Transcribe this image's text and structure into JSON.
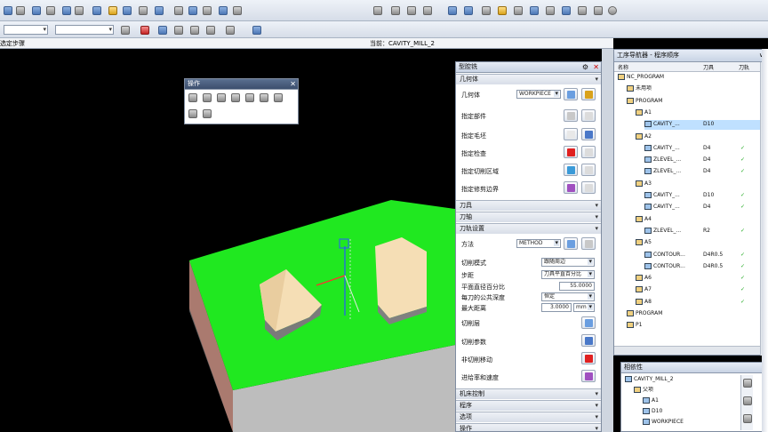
{
  "toolbar": {
    "row2": {
      "filter_value": "",
      "selection_value": ""
    }
  },
  "viewport": {
    "left_caption": "选定步骤",
    "center_caption": "当前：CAVITY_MILL_2",
    "floating_toolbar": {
      "title": "操作"
    },
    "colors": {
      "part_top": "#20e820",
      "part_side": "#bcbcbc",
      "blocks": "#f5deb5",
      "background": "#000000"
    }
  },
  "dialog": {
    "title": "型腔铣",
    "sections": {
      "geometry": "几何体",
      "tool": "刀具",
      "tool_axis": "刀轴",
      "path_settings": "刀轨设置",
      "machine_control": "机床控制",
      "program": "程序",
      "options": "选项",
      "actions": "操作"
    },
    "geometry": {
      "geometry_label": "几何体",
      "geometry_value": "WORKPIECE",
      "specify_part": "指定部件",
      "specify_blank": "指定毛坯",
      "specify_check": "指定检查",
      "specify_cut_area": "指定切削区域",
      "specify_trim": "指定修剪边界"
    },
    "path": {
      "method_label": "方法",
      "method_value": "METHOD",
      "cut_mode_label": "切削模式",
      "cut_mode_value": "跟随周边",
      "stepover_label": "步距",
      "stepover_value": "刀具平直百分比",
      "percent_label": "平面直径百分比",
      "percent_value": "55.0000",
      "global_depth_label": "每刀的公共深度",
      "global_depth_value": "恒定",
      "max_distance_label": "最大距离",
      "max_distance_value": "3.0000",
      "max_distance_unit": "mm",
      "cut_levels": "切削层",
      "cut_params": "切削参数",
      "non_cut_moves": "非切削移动",
      "feeds_speeds": "进给率和速度"
    }
  },
  "navigator": {
    "title": "工序导航器 - 程序顺序",
    "columns": {
      "name": "名称",
      "tool": "刀具",
      "path": "刀轨"
    },
    "rows": [
      {
        "indent": 0,
        "text": "NC_PROGRAM",
        "tool": "",
        "check": ""
      },
      {
        "indent": 1,
        "text": "未用项",
        "tool": "",
        "check": ""
      },
      {
        "indent": 1,
        "text": "PROGRAM",
        "tool": "",
        "check": ""
      },
      {
        "indent": 2,
        "text": "A1",
        "tool": "",
        "check": ""
      },
      {
        "indent": 3,
        "text": "CAVITY_...",
        "tool": "D10",
        "check": ""
      },
      {
        "indent": 2,
        "text": "A2",
        "tool": "",
        "check": ""
      },
      {
        "indent": 3,
        "text": "CAVITY_...",
        "tool": "D4",
        "check": "✓"
      },
      {
        "indent": 3,
        "text": "ZLEVEL_...",
        "tool": "D4",
        "check": "✓"
      },
      {
        "indent": 3,
        "text": "ZLEVEL_...",
        "tool": "D4",
        "check": "✓"
      },
      {
        "indent": 2,
        "text": "A3",
        "tool": "",
        "check": ""
      },
      {
        "indent": 3,
        "text": "CAVITY_...",
        "tool": "D10",
        "check": "✓"
      },
      {
        "indent": 3,
        "text": "CAVITY_...",
        "tool": "D4",
        "check": "✓"
      },
      {
        "indent": 2,
        "text": "A4",
        "tool": "",
        "check": ""
      },
      {
        "indent": 3,
        "text": "ZLEVEL_...",
        "tool": "R2",
        "check": "✓"
      },
      {
        "indent": 2,
        "text": "A5",
        "tool": "",
        "check": ""
      },
      {
        "indent": 3,
        "text": "CONTOUR...",
        "tool": "D4R0.5",
        "check": "✓"
      },
      {
        "indent": 3,
        "text": "CONTOUR...",
        "tool": "D4R0.5",
        "check": "✓"
      },
      {
        "indent": 2,
        "text": "A6",
        "tool": "",
        "check": "✓"
      },
      {
        "indent": 2,
        "text": "A7",
        "tool": "",
        "check": "✓"
      },
      {
        "indent": 2,
        "text": "A8",
        "tool": "",
        "check": "✓"
      },
      {
        "indent": 1,
        "text": "PROGRAM",
        "tool": "",
        "check": ""
      },
      {
        "indent": 1,
        "text": "P1",
        "tool": "",
        "check": ""
      }
    ]
  },
  "dependencies": {
    "title": "相依性",
    "rows": [
      {
        "indent": 0,
        "text": "CAVITY_MILL_2"
      },
      {
        "indent": 1,
        "text": "父项"
      },
      {
        "indent": 2,
        "text": "A1"
      },
      {
        "indent": 2,
        "text": "D10"
      },
      {
        "indent": 2,
        "text": "WORKPIECE"
      }
    ]
  }
}
